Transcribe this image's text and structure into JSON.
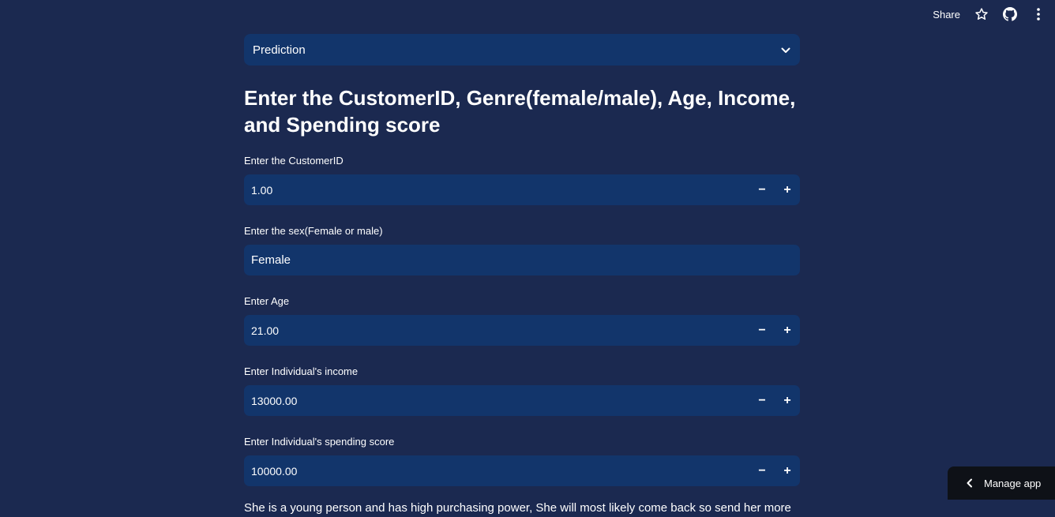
{
  "toolbar": {
    "share_label": "Share",
    "icons": [
      "star-icon",
      "github-icon",
      "more-vertical-icon"
    ]
  },
  "select": {
    "value": "Prediction"
  },
  "heading": "Enter the CustomerID, Genre(female/male), Age, Income, and Spending score",
  "fields": [
    {
      "label": "Enter the CustomerID",
      "value": "1.00",
      "type": "number"
    },
    {
      "label": "Enter the sex(Female or male)",
      "value": "Female",
      "type": "text"
    },
    {
      "label": "Enter Age",
      "value": "21.00",
      "type": "number"
    },
    {
      "label": "Enter Individual's income",
      "value": "13000.00",
      "type": "number"
    },
    {
      "label": "Enter Individual's spending score",
      "value": "10000.00",
      "type": "number"
    }
  ],
  "stepper": {
    "minus": "−",
    "plus": "+"
  },
  "result": "She is a young person and has high purchasing power, She will most likely come back so send her more",
  "manage_app": {
    "label": "Manage app"
  },
  "colors": {
    "background": "#1b2950",
    "input": "#12356b",
    "manage_bg": "#0e1117"
  }
}
